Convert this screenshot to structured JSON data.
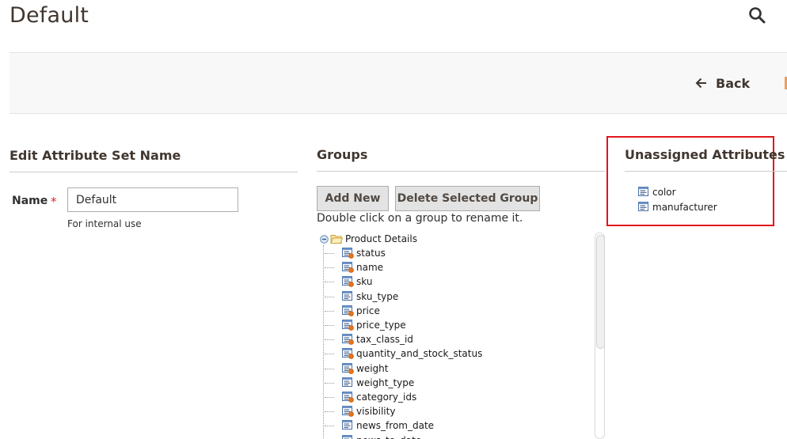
{
  "page": {
    "title": "Default"
  },
  "header": {
    "search_icon": "magnifier-icon"
  },
  "actions": {
    "back_label": "Back"
  },
  "edit_section": {
    "title": "Edit Attribute Set Name",
    "name_label": "Name",
    "required_mark": "*",
    "name_value": "Default",
    "name_note": "For internal use"
  },
  "groups_section": {
    "title": "Groups",
    "add_new_label": "Add New",
    "delete_group_label": "Delete Selected Group",
    "hint": "Double click on a group to rename it.",
    "tree": {
      "group_label": "Product Details",
      "items": [
        {
          "label": "status",
          "icon": "attribute-system-icon"
        },
        {
          "label": "name",
          "icon": "attribute-system-icon"
        },
        {
          "label": "sku",
          "icon": "attribute-system-icon"
        },
        {
          "label": "sku_type",
          "icon": "attribute-user-icon"
        },
        {
          "label": "price",
          "icon": "attribute-system-icon"
        },
        {
          "label": "price_type",
          "icon": "attribute-system-icon"
        },
        {
          "label": "tax_class_id",
          "icon": "attribute-system-icon"
        },
        {
          "label": "quantity_and_stock_status",
          "icon": "attribute-system-icon"
        },
        {
          "label": "weight",
          "icon": "attribute-system-icon"
        },
        {
          "label": "weight_type",
          "icon": "attribute-user-icon"
        },
        {
          "label": "category_ids",
          "icon": "attribute-system-icon"
        },
        {
          "label": "visibility",
          "icon": "attribute-system-icon"
        },
        {
          "label": "news_from_date",
          "icon": "attribute-user-icon"
        },
        {
          "label": "news_to_date",
          "icon": "attribute-user-icon"
        }
      ]
    }
  },
  "unassigned_section": {
    "title": "Unassigned Attributes",
    "items": [
      {
        "label": "color",
        "icon": "attribute-user-icon"
      },
      {
        "label": "manufacturer",
        "icon": "attribute-user-icon"
      }
    ]
  },
  "colors": {
    "accent_orange": "#eb5202",
    "highlight_red": "#e0161b",
    "required_red": "#e22626",
    "button_gray": "#e3e3e3"
  }
}
